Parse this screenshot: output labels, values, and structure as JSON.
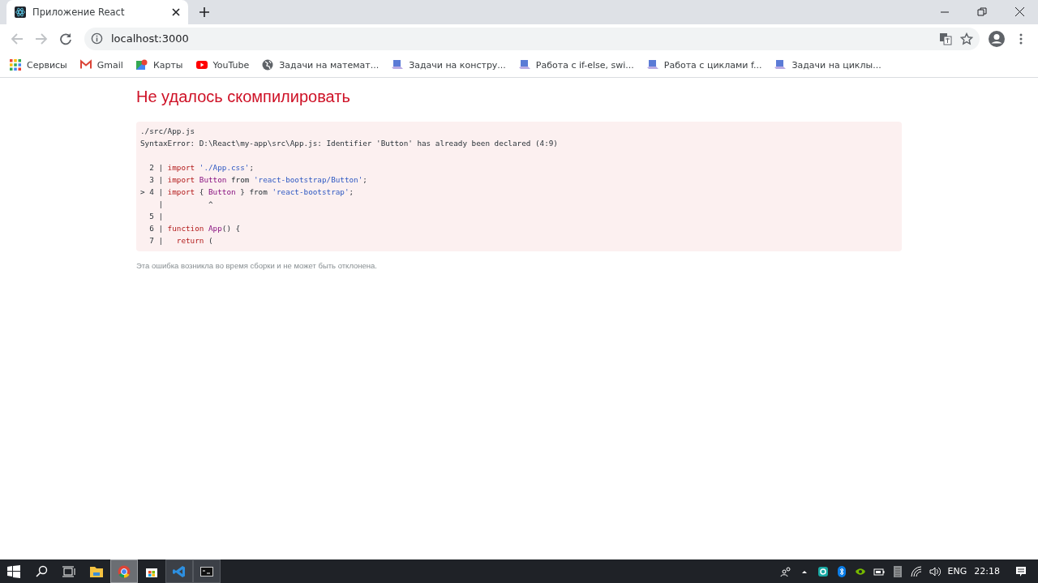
{
  "browser": {
    "tab": {
      "title": "Приложение React",
      "selected": true
    },
    "address": "localhost:3000",
    "bookmarks": [
      {
        "kind": "apps",
        "label": "Сервисы"
      },
      {
        "kind": "gmail",
        "label": "Gmail"
      },
      {
        "kind": "maps",
        "label": "Карты"
      },
      {
        "kind": "youtube",
        "label": "YouTube"
      },
      {
        "kind": "globe",
        "label": "Задачи на математ..."
      },
      {
        "kind": "computer",
        "label": "Задачи на констру..."
      },
      {
        "kind": "computer",
        "label": "Работа с if-else, swi..."
      },
      {
        "kind": "computer",
        "label": "Работа с циклами f..."
      },
      {
        "kind": "computer",
        "label": "Задачи на циклы..."
      }
    ]
  },
  "error": {
    "title": "Не удалось скомпилировать",
    "message": [
      "./src/App.js",
      "SyntaxError: D:\\React\\my-app\\src\\App.js: Identifier 'Button' has already been declared (4:9)"
    ],
    "code_lines": [
      {
        "gutter": "  2 |",
        "tokens": [
          {
            "kind": "keyword",
            "text": "import"
          },
          {
            "kind": "string",
            "text": " './App.css'"
          },
          {
            "kind": "plain",
            "text": ";"
          }
        ]
      },
      {
        "gutter": "  3 |",
        "tokens": [
          {
            "kind": "keyword",
            "text": "import"
          },
          {
            "kind": "ident",
            "text": " Button"
          },
          {
            "kind": "plain",
            "text": " from "
          },
          {
            "kind": "string",
            "text": "'react-bootstrap/Button'"
          },
          {
            "kind": "plain",
            "text": ";"
          }
        ]
      },
      {
        "gutter": "> 4 |",
        "tokens": [
          {
            "kind": "keyword",
            "text": "import"
          },
          {
            "kind": "plain",
            "text": " { "
          },
          {
            "kind": "ident",
            "text": "Button"
          },
          {
            "kind": "plain",
            "text": " } from "
          },
          {
            "kind": "string",
            "text": "'react-bootstrap'"
          },
          {
            "kind": "plain",
            "text": ";"
          }
        ]
      },
      {
        "gutter": "    |",
        "tokens": [
          {
            "kind": "caret",
            "text": "         ^"
          }
        ]
      },
      {
        "gutter": "  5 |"
      },
      {
        "gutter": "  6 |",
        "tokens": [
          {
            "kind": "keyword",
            "text": "function"
          },
          {
            "kind": "ident",
            "text": " App"
          },
          {
            "kind": "plain",
            "text": "() {"
          }
        ]
      },
      {
        "gutter": "  7 |",
        "tokens": [
          {
            "kind": "keyword",
            "text": "  return"
          },
          {
            "kind": "plain",
            "text": " ("
          }
        ]
      }
    ],
    "note": "Эта ошибка возникла во время сборки и не может быть отклонена."
  },
  "taskbar": {
    "language": "ENG",
    "time": "22:18"
  }
}
